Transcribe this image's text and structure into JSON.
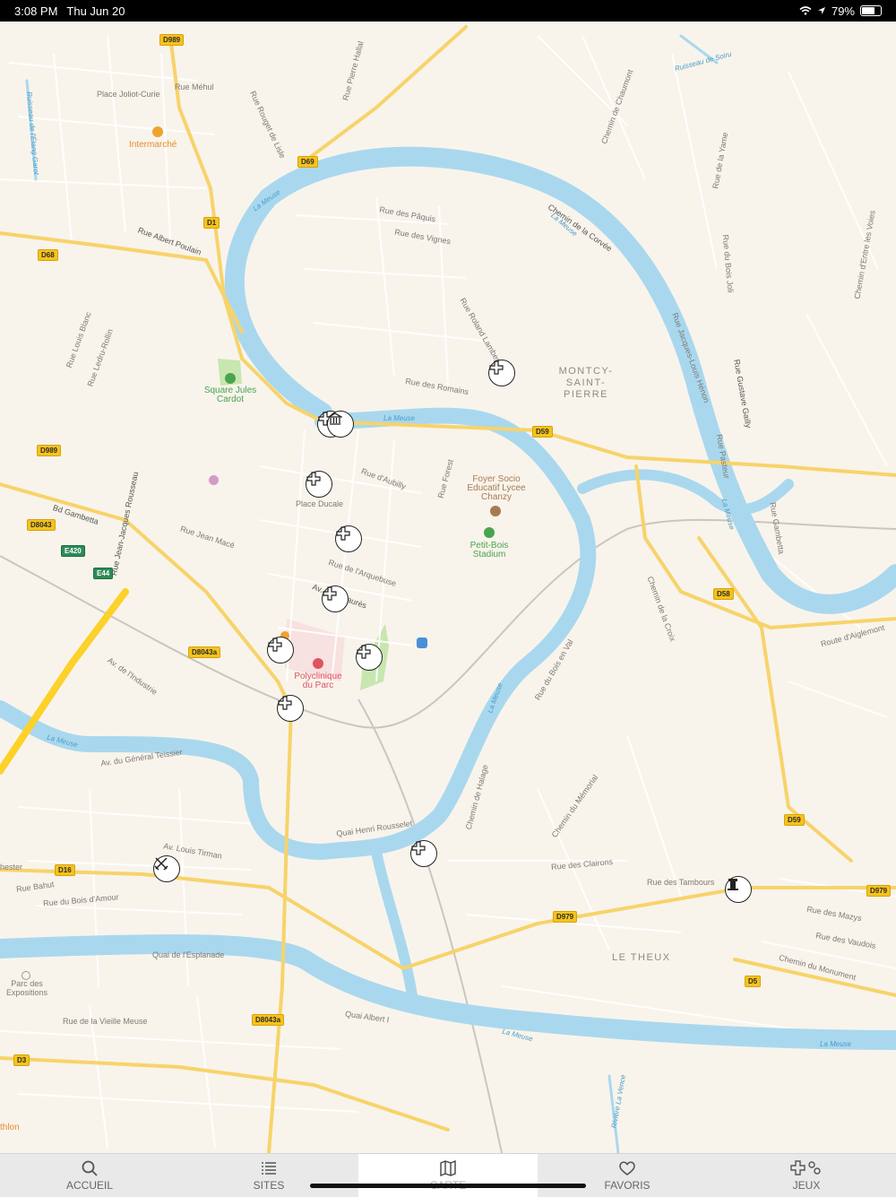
{
  "status": {
    "time": "3:08 PM",
    "date": "Thu Jun 20",
    "battery": "79%",
    "battery_level": 0.79
  },
  "map": {
    "labels": {
      "intermarche": "Intermarché",
      "square": "Square Jules Cardot",
      "place_ducale": "Place Ducale",
      "foyer": "Foyer Socio Educatif Lycee Chanzy",
      "stadium": "Petit-Bois Stadium",
      "polyclinique": "Polyclinique du Parc",
      "montcy": "MONTCY-SAINT-PIERRE",
      "le_theux": "LE THEUX",
      "parc_expo": "Parc des Expositions",
      "athlon": "thlon",
      "place_joliot": "Place Joliot-Curie",
      "rue_mehul": "Rue Méhul",
      "rue_albert_poulain": "Rue Albert Poulain",
      "rue_louis_blanc": "Rue Louis Blanc",
      "rue_ledru": "Rue Ledru-Rollin",
      "rue_pierre": "Rue Pierre Hallal",
      "rue_rouget": "Rue Rouget de Lisle",
      "rue_paquis": "Rue des Pâquis",
      "rue_vignes": "Rue des Vignes",
      "rue_romains": "Rue des Romains",
      "rue_roland": "Rue Roland Lambert",
      "rue_aubilly": "Rue d'Aubilly",
      "rue_forest": "Rue Forest",
      "rue_jean_mace": "Rue Jean Macé",
      "rue_arquebuse": "Rue de l'Arquebuse",
      "av_jaures": "Av. Jean Jaurès",
      "bd_gambetta": "Bd Gambetta",
      "rue_jjr": "Rue Jean-Jacques Rousseau",
      "av_industrie": "Av. de l'Industrie",
      "av_teissier": "Av. du Général Teissier",
      "quai_rousselet": "Quai Henri Rousselet",
      "av_tirman": "Av. Louis Tirman",
      "rue_bois_amour": "Rue du Bois d'Amour",
      "quai_esplanade": "Quai de l'Esplanade",
      "rue_vieille_meuse": "Rue de la Vieille Meuse",
      "quai_albert": "Quai Albert I",
      "chemin_corvee": "Chemin de la Corvée",
      "rue_gustave": "Rue Gustave Gailly",
      "rue_pasteur": "Rue Pasteur",
      "rue_gambetta": "Rue Gambetta",
      "rue_jacques": "Rue Jacques-Louis Hénon",
      "route_aiglemont": "Route d'Aiglemont",
      "chemin_croix": "Chemin de la Croix",
      "rue_bois_en_val": "Rue du Bois en Val",
      "chemin_halage": "Chemin de Halage",
      "chemin_memorial": "Chemin du Mémorial",
      "rue_clairons": "Rue des Clairons",
      "rue_tambours": "Rue des Tambours",
      "rue_mazys": "Rue des Mazys",
      "rue_vaudois": "Rue des Vaudois",
      "chemin_monument": "Chemin du Monument",
      "chemin_chaumont": "Chemin de Chaumont",
      "ruisseau_soiru": "Ruisseau de Soiru",
      "ruisseau_etang": "Ruisseau de l'Étang Garot",
      "riviere_vence": "Rivière La Vence",
      "rue_yame": "Rue de la Yame",
      "rue_bois_joli": "Rue du Bois Joli",
      "chemin_voies": "Chemin d'Entre les Voies",
      "rue_bahut": "Rue Bahut",
      "chester": "hester",
      "la_meuse": "La Meuse"
    },
    "shields": [
      "D989",
      "D69",
      "D1",
      "D68",
      "D989",
      "D8043",
      "E420",
      "E44",
      "D8043a",
      "D59",
      "D58",
      "D59",
      "D16",
      "D979",
      "D979",
      "D5",
      "D8043a",
      "D3"
    ],
    "pins": [
      "cross-pin",
      "cross-pin",
      "museum-pin",
      "cross-pin",
      "cross-pin",
      "cross-pin",
      "cross-pin",
      "cross-pin",
      "cross-pin",
      "cross-pin",
      "swords-pin",
      "monument-pin"
    ]
  },
  "tabs": [
    {
      "label": "ACCUEIL",
      "icon": "search-icon"
    },
    {
      "label": "SITES",
      "icon": "list-icon"
    },
    {
      "label": "CARTE",
      "icon": "map-icon"
    },
    {
      "label": "FAVORIS",
      "icon": "heart-icon"
    },
    {
      "label": "JEUX",
      "icon": "games-icon"
    }
  ],
  "colors": {
    "water": "#a9d8ee",
    "land": "#f8f4ec",
    "road": "#f7d36a",
    "highway": "#fcd12a",
    "park": "#c8e6b0"
  }
}
